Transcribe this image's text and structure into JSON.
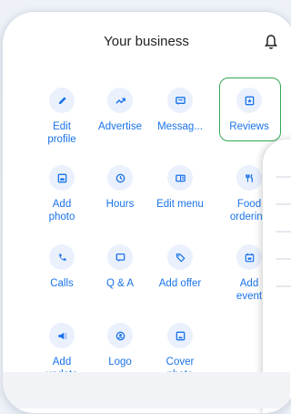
{
  "header": {
    "title": "Your business"
  },
  "grid": [
    {
      "label": "Edit\nprofile",
      "icon": "pencil-icon"
    },
    {
      "label": "Advertise",
      "icon": "trending-up-icon"
    },
    {
      "label": "Messag...",
      "icon": "message-icon"
    },
    {
      "label": "Reviews",
      "icon": "star-box-icon"
    },
    {
      "label": "Add\nphoto",
      "icon": "image-icon"
    },
    {
      "label": "Hours",
      "icon": "clock-icon"
    },
    {
      "label": "Edit menu",
      "icon": "menu-book-icon"
    },
    {
      "label": "Food\nordering",
      "icon": "cutlery-icon"
    },
    {
      "label": "Calls",
      "icon": "phone-icon"
    },
    {
      "label": "Q & A",
      "icon": "chat-bubble-icon"
    },
    {
      "label": "Add offer",
      "icon": "tag-icon"
    },
    {
      "label": "Add\nevent",
      "icon": "calendar-icon"
    },
    {
      "label": "Add\nupdate",
      "icon": "megaphone-icon"
    },
    {
      "label": "Logo",
      "icon": "logo-badge-icon"
    },
    {
      "label": "Cover\nphoto",
      "icon": "cover-photo-icon"
    }
  ],
  "colors": {
    "accent": "#1a73e8",
    "icon_bg": "#eaf1fd",
    "highlight": "#34a853"
  }
}
